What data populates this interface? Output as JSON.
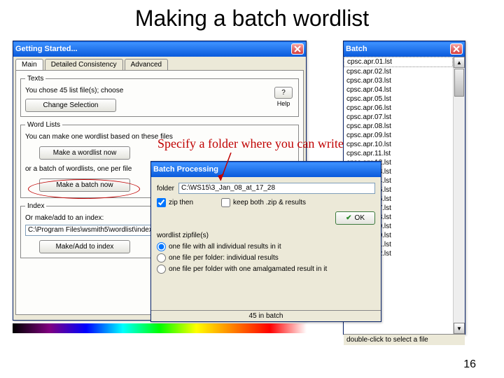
{
  "slide": {
    "title": "Making a batch wordlist",
    "page_number": "16"
  },
  "annotation": {
    "text": "Specify a folder where you can write"
  },
  "getting_started": {
    "title": "Getting Started...",
    "tabs": [
      "Main",
      "Detailed Consistency",
      "Advanced"
    ],
    "texts_legend": "Texts",
    "texts_status": "You chose 45 list file(s); choose",
    "change_selection": "Change Selection",
    "help_icon": "?",
    "help_label": "Help",
    "wordlist_legend": "Word Lists",
    "wordlist_instruction": "You can make one wordlist based on these files",
    "make_now": "Make a wordlist now",
    "or_batch": "or a batch of wordlists, one per file",
    "make_batch": "Make a batch now",
    "index_legend": "Index",
    "index_instruction": "Or make/add to an index:",
    "index_path": "C:\\Program Files\\wsmith5\\wordlist\\index\\main",
    "make_add_index": "Make/Add to index"
  },
  "batch": {
    "title": "Batch",
    "files": [
      "cpsc.apr.01.lst",
      "cpsc.apr.02.lst",
      "cpsc.apr.03.lst",
      "cpsc.apr.04.lst",
      "cpsc.apr.05.lst",
      "cpsc.apr.06.lst",
      "cpsc.apr.07.lst",
      "cpsc.apr.08.lst",
      "cpsc.apr.09.lst",
      "cpsc.apr.10.lst",
      "cpsc.apr.11.lst",
      "cpsc.apr.12.lst",
      "cpsc.apr.13.lst",
      "cpsc.apr.14.lst",
      "cpsc.apr.15.lst",
      "cpsc.apr.16.lst",
      "cpsc.apr.17.lst",
      "cpsc.apr.18.lst",
      "cpsc.apr.19.lst",
      "cpsc.apr.20.lst",
      "cpsc.apr.21.lst",
      "cpsc.apr.22.lst"
    ],
    "status": "double-click to select a file"
  },
  "batch_processing": {
    "title": "Batch Processing",
    "folder_label": "folder",
    "folder_value": "C:\\WS15\\3_Jan_08_at_17_28",
    "zip_then": "zip then",
    "keep_both": "keep both .zip & results",
    "ok": "OK",
    "zipfiles_label": "wordlist zipfile(s)",
    "radio1": "one file with all individual results in it",
    "radio2": "one file per folder: individual results",
    "radio3": "one file per folder with one amalgamated result in it",
    "status": "45 in batch"
  }
}
